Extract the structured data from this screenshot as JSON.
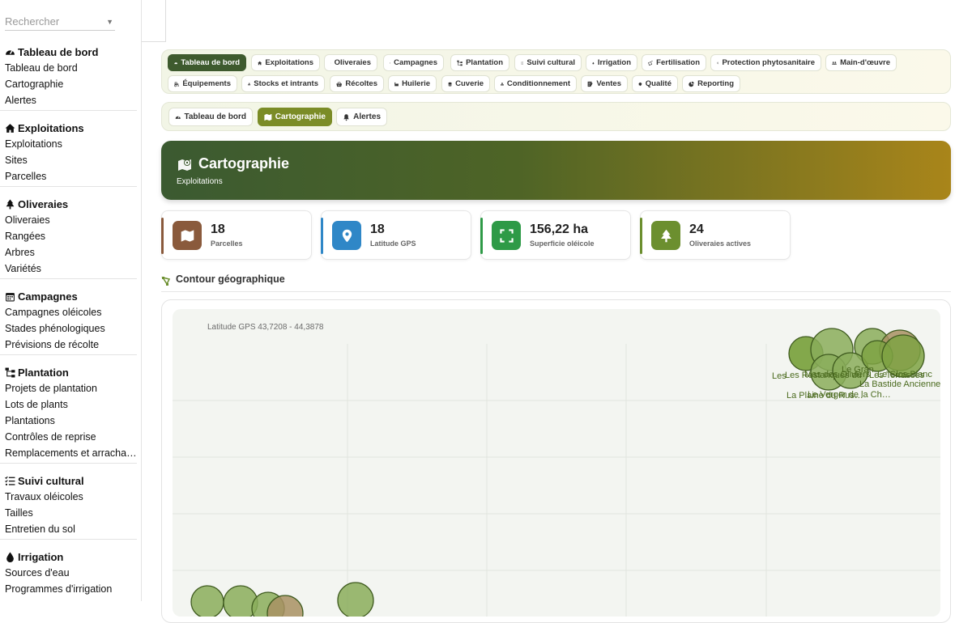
{
  "search": {
    "placeholder": "Rechercher"
  },
  "sidebar": [
    {
      "title": "Tableau de bord",
      "icon": "gauge-icon",
      "items": [
        "Tableau de bord",
        "Cartographie",
        "Alertes"
      ]
    },
    {
      "title": "Exploitations",
      "icon": "home-icon",
      "items": [
        "Exploitations",
        "Sites",
        "Parcelles"
      ]
    },
    {
      "title": "Oliveraies",
      "icon": "tree-icon",
      "items": [
        "Oliveraies",
        "Rangées",
        "Arbres",
        "Variétés"
      ]
    },
    {
      "title": "Campagnes",
      "icon": "calendar-icon",
      "items": [
        "Campagnes oléicoles",
        "Stades phénologiques",
        "Prévisions de récolte"
      ]
    },
    {
      "title": "Plantation",
      "icon": "sitemap-icon",
      "items": [
        "Projets de plantation",
        "Lots de plants",
        "Plantations",
        "Contrôles de reprise",
        "Remplacements et arrachages"
      ]
    },
    {
      "title": "Suivi cultural",
      "icon": "list-check-icon",
      "items": [
        "Travaux oléicoles",
        "Tailles",
        "Entretien du sol"
      ]
    },
    {
      "title": "Irrigation",
      "icon": "drop-icon",
      "items": [
        "Sources d'eau",
        "Programmes d'irrigation"
      ]
    }
  ],
  "main_tabs": [
    {
      "label": "Tableau de bord",
      "icon": "gauge-icon",
      "active": true
    },
    {
      "label": "Exploitations",
      "icon": "home-icon"
    },
    {
      "label": "Oliveraies",
      "icon": "tree-icon"
    },
    {
      "label": "Campagnes",
      "icon": "calendar-icon"
    },
    {
      "label": "Plantation",
      "icon": "sitemap-icon"
    },
    {
      "label": "Suivi cultural",
      "icon": "list-check-icon"
    },
    {
      "label": "Irrigation",
      "icon": "drop-icon"
    },
    {
      "label": "Fertilisation",
      "icon": "spray-icon"
    },
    {
      "label": "Protection phytosanitaire",
      "icon": "shield-icon"
    },
    {
      "label": "Main-d'œuvre",
      "icon": "users-icon"
    },
    {
      "label": "Équipements",
      "icon": "tractor-icon"
    },
    {
      "label": "Stocks et intrants",
      "icon": "boxes-icon"
    },
    {
      "label": "Récoltes",
      "icon": "basket-icon"
    },
    {
      "label": "Huilerie",
      "icon": "industry-icon"
    },
    {
      "label": "Cuverie",
      "icon": "database-icon"
    },
    {
      "label": "Conditionnement",
      "icon": "boxes-icon"
    },
    {
      "label": "Ventes",
      "icon": "receipt-icon"
    },
    {
      "label": "Qualité",
      "icon": "badge-icon"
    },
    {
      "label": "Reporting",
      "icon": "chart-pie-icon"
    }
  ],
  "sub_tabs": [
    {
      "label": "Tableau de bord",
      "icon": "gauge-icon"
    },
    {
      "label": "Cartographie",
      "icon": "map-icon",
      "active": true
    },
    {
      "label": "Alertes",
      "icon": "bell-icon"
    }
  ],
  "hero": {
    "title": "Cartographie",
    "subtitle": "Exploitations",
    "icon": "map-location-icon"
  },
  "kpis": [
    {
      "value": "18",
      "label": "Parcelles",
      "icon": "map-icon",
      "color": "#8a5a3c"
    },
    {
      "value": "18",
      "label": "Latitude GPS",
      "icon": "pin-icon",
      "color": "#2f87c7"
    },
    {
      "value": "156,22 ha",
      "label": "Superficie oléicole",
      "icon": "expand-icon",
      "color": "#2e9a47"
    },
    {
      "value": "24",
      "label": "Oliveraies actives",
      "icon": "tree-icon",
      "color": "#6c8f2f"
    }
  ],
  "section_title": "Contour géographique",
  "map": {
    "coord_label": "Latitude GPS 43,7208 - 44,3878",
    "labels": [
      "Les",
      "Le Gran",
      "Les Restanques du",
      "Les Terrasses",
      "La Bastide Ancienne",
      "Le Verger de la Ch…",
      "La Plaine du Rus…",
      "Mas des Oliviers",
      "Le Clos Blanc"
    ]
  }
}
